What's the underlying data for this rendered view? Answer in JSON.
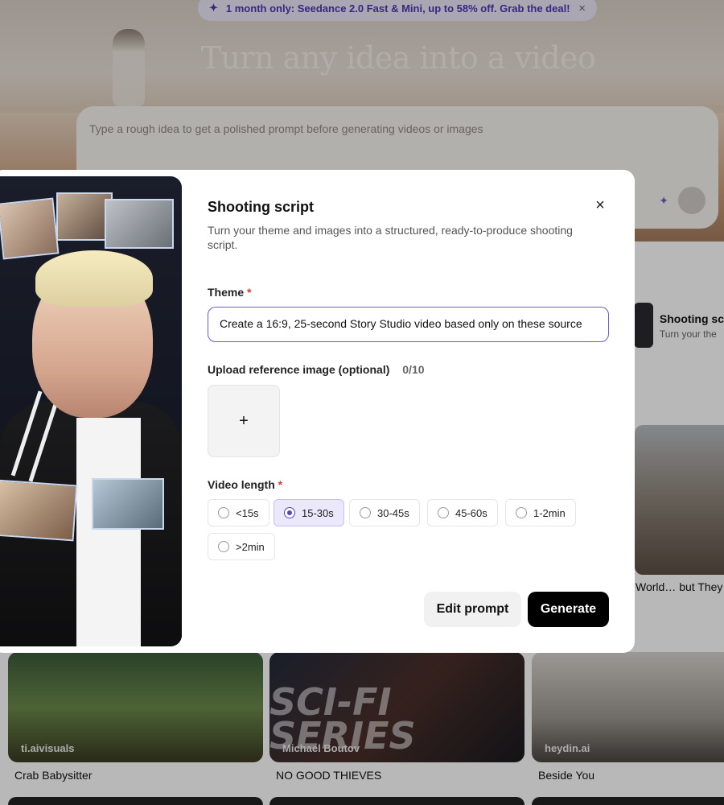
{
  "promo_banner": {
    "text": "1 month only: Seedance 2.0 Fast & Mini, up to 58% off. Grab the deal!",
    "close": "×"
  },
  "hero": {
    "title": "Turn any idea into a video",
    "prompt_placeholder": "Type a rough idea to get a polished prompt before generating videos or images"
  },
  "side_card": {
    "title": "Shooting sc",
    "subtitle": "Turn your the",
    "caption": "World… but They"
  },
  "gallery": [
    {
      "creator": "ti.aivisuals",
      "title": "Crab Babysitter"
    },
    {
      "creator": "Michael Boutov",
      "title": "NO GOOD THIEVES",
      "overlay": "SCI-FI SERIES"
    },
    {
      "creator": "heydin.ai",
      "title": "Beside You"
    }
  ],
  "modal": {
    "title": "Shooting script",
    "subtitle": "Turn your theme and images into a structured, ready-to-produce shooting script.",
    "close": "×",
    "theme_label": "Theme",
    "required_mark": "*",
    "theme_value": "Create a 16:9, 25-second Story Studio video based only on these source",
    "upload_label": "Upload reference image (optional)",
    "upload_count": "0/10",
    "upload_plus": "+",
    "length_label": "Video length",
    "length_options": [
      "<15s",
      "15-30s",
      "30-45s",
      "45-60s",
      "1-2min",
      ">2min"
    ],
    "length_selected": "15-30s",
    "edit_button": "Edit prompt",
    "generate_button": "Generate"
  },
  "colors": {
    "accent": "#5645c9",
    "required": "#e0382b",
    "generate_bg": "#000000"
  }
}
